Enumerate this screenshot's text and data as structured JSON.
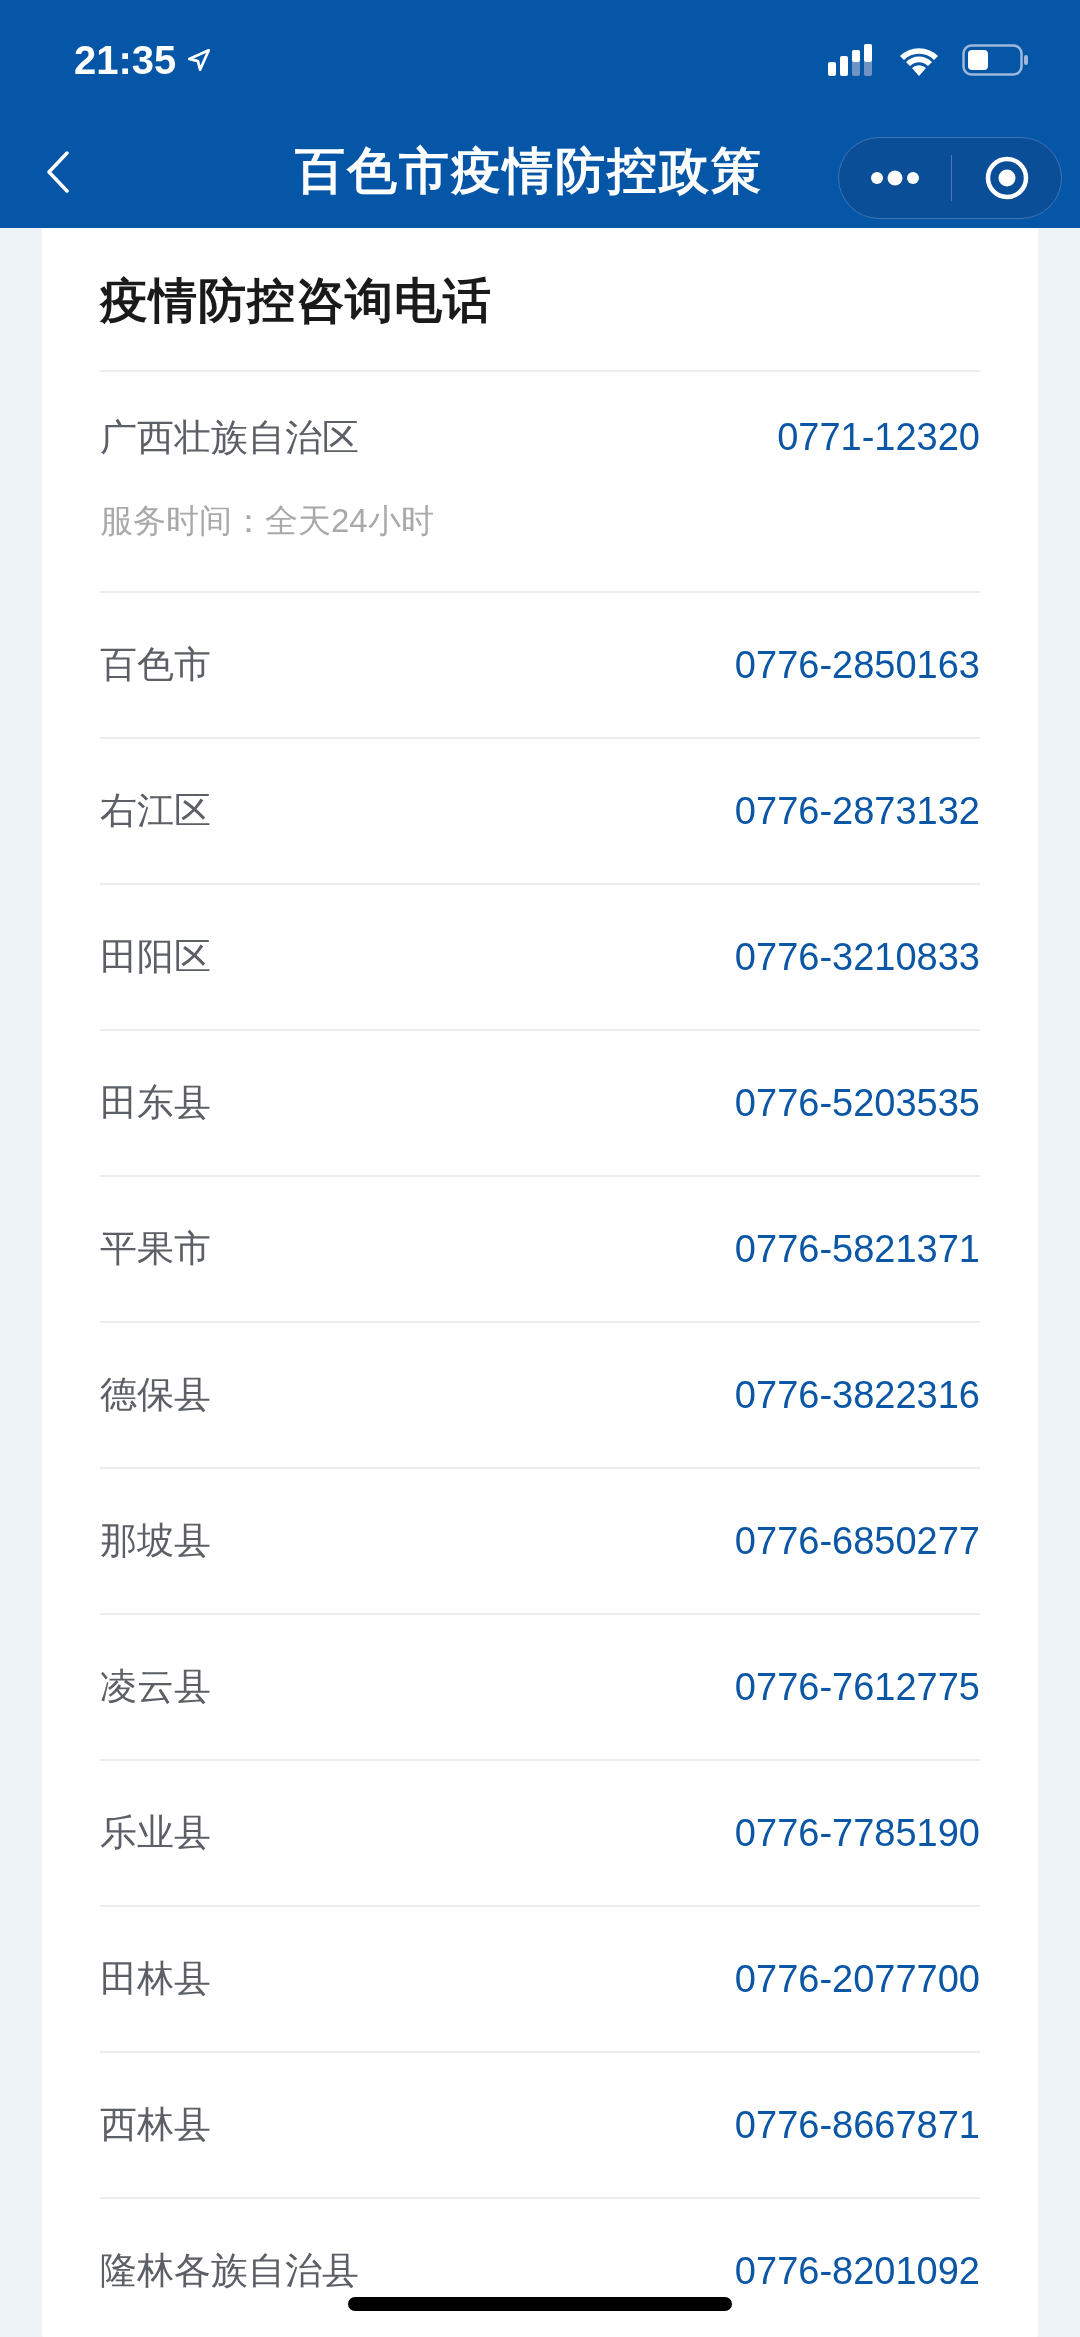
{
  "status_bar": {
    "time": "21:35"
  },
  "nav": {
    "title": "百色市疫情防控政策"
  },
  "card": {
    "title": "疫情防控咨询电话",
    "rows": [
      {
        "name": "广西壮族自治区",
        "phone": "0771-12320",
        "note": "服务时间：全天24小时"
      },
      {
        "name": "百色市",
        "phone": "0776-2850163"
      },
      {
        "name": "右江区",
        "phone": "0776-2873132"
      },
      {
        "name": "田阳区",
        "phone": "0776-3210833"
      },
      {
        "name": "田东县",
        "phone": "0776-5203535"
      },
      {
        "name": "平果市",
        "phone": "0776-5821371"
      },
      {
        "name": "德保县",
        "phone": "0776-3822316"
      },
      {
        "name": "那坡县",
        "phone": "0776-6850277"
      },
      {
        "name": "凌云县",
        "phone": "0776-7612775"
      },
      {
        "name": "乐业县",
        "phone": "0776-7785190"
      },
      {
        "name": "田林县",
        "phone": "0776-2077700"
      },
      {
        "name": "西林县",
        "phone": "0776-8667871"
      },
      {
        "name": "隆林各族自治县",
        "phone": "0776-8201092"
      }
    ]
  }
}
